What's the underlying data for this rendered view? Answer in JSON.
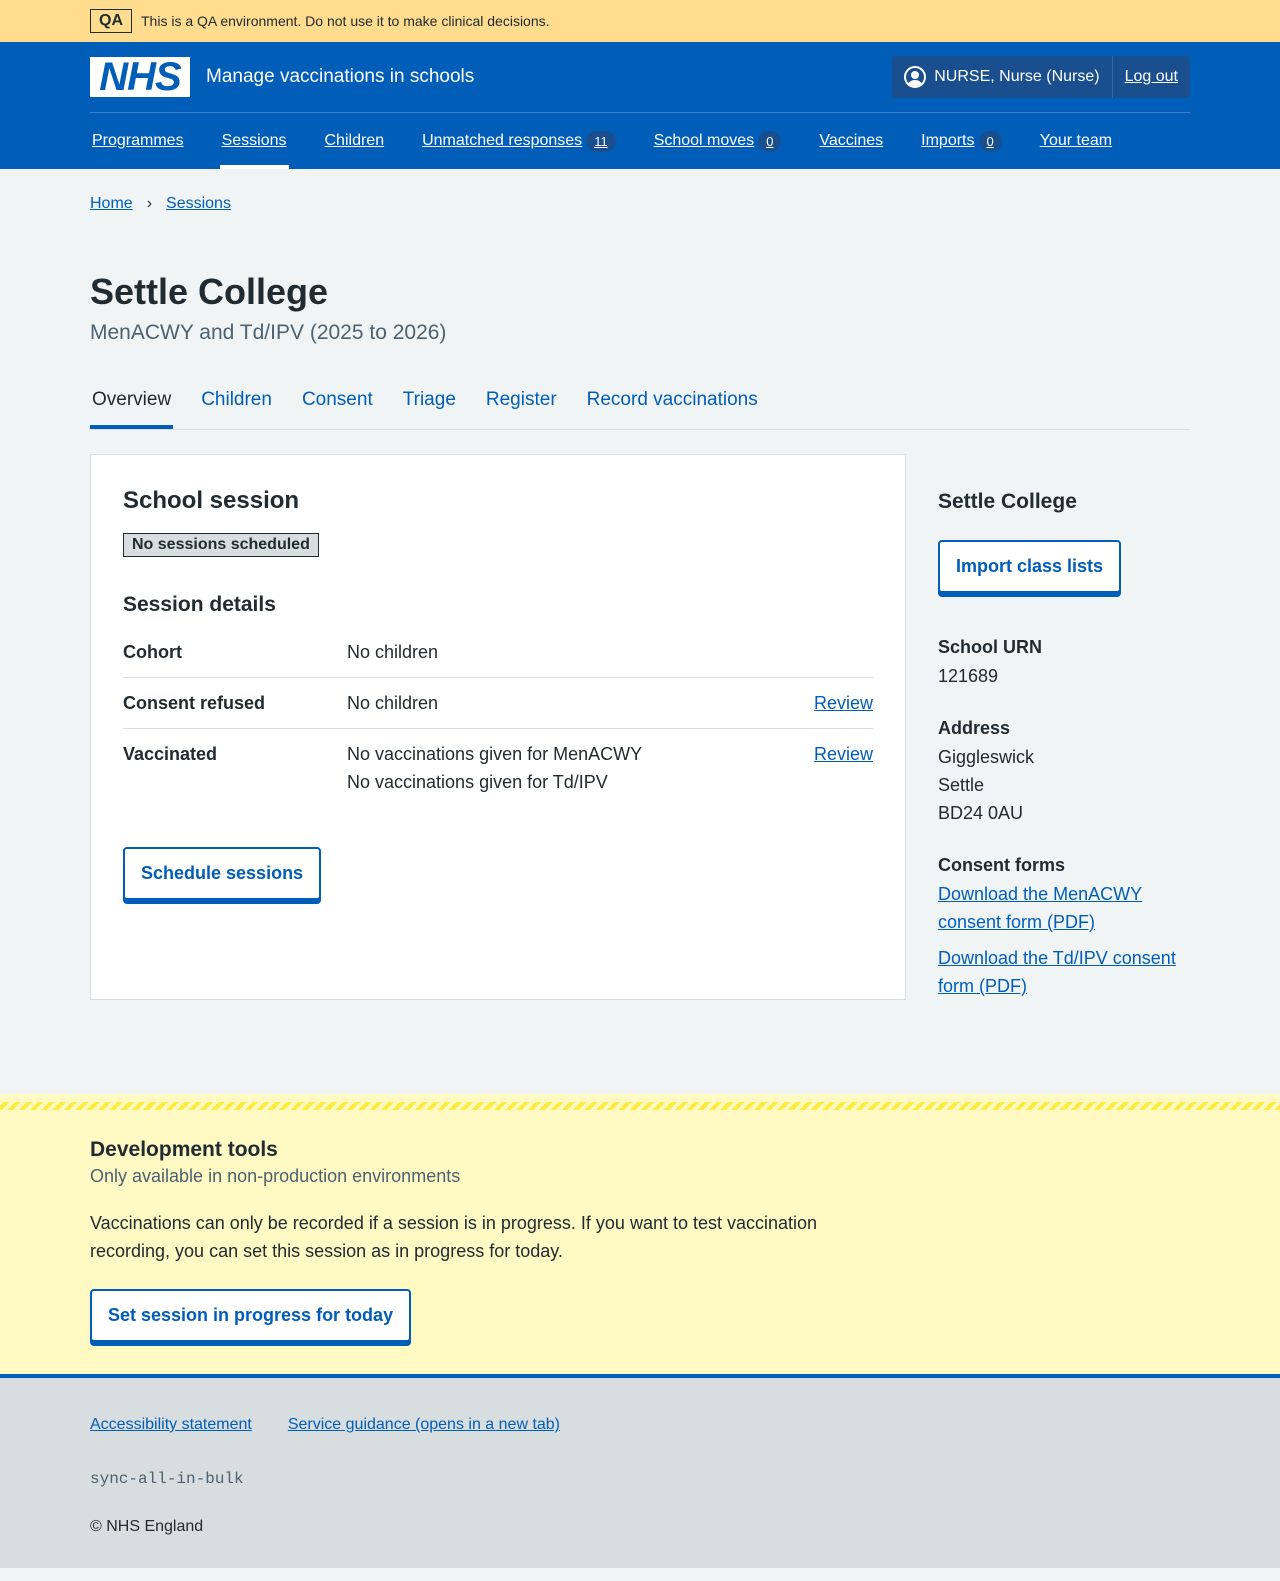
{
  "qa": {
    "tag": "QA",
    "text": "This is a QA environment. Do not use it to make clinical decisions."
  },
  "header": {
    "logo": "NHS",
    "service": "Manage vaccinations in schools",
    "user": "NURSE, Nurse (Nurse)",
    "logout": "Log out"
  },
  "nav": [
    {
      "label": "Programmes"
    },
    {
      "label": "Sessions",
      "current": true
    },
    {
      "label": "Children"
    },
    {
      "label": "Unmatched responses",
      "count": "11"
    },
    {
      "label": "School moves",
      "count": "0"
    },
    {
      "label": "Vaccines"
    },
    {
      "label": "Imports",
      "count": "0"
    },
    {
      "label": "Your team"
    }
  ],
  "breadcrumb": [
    "Home",
    "Sessions"
  ],
  "page": {
    "title": "Settle College",
    "caption": "MenACWY and Td/IPV (2025 to 2026)"
  },
  "tabs": [
    "Overview",
    "Children",
    "Consent",
    "Triage",
    "Register",
    "Record vaccinations"
  ],
  "session": {
    "title": "School session",
    "status": "No sessions scheduled",
    "details_title": "Session details",
    "rows": [
      {
        "key": "Cohort",
        "values": [
          "No children"
        ],
        "action": ""
      },
      {
        "key": "Consent refused",
        "values": [
          "No children"
        ],
        "action": "Review"
      },
      {
        "key": "Vaccinated",
        "values": [
          "No vaccinations given for MenACWY",
          "No vaccinations given for Td/IPV"
        ],
        "action": "Review"
      }
    ],
    "button": "Schedule sessions"
  },
  "side": {
    "title": "Settle College",
    "import": "Import class lists",
    "urn_label": "School URN",
    "urn": "121689",
    "address_label": "Address",
    "address": [
      "Giggleswick",
      "Settle",
      "BD24 0AU"
    ],
    "forms_label": "Consent forms",
    "forms": [
      "Download the MenACWY consent form (PDF)",
      "Download the Td/IPV consent form (PDF)"
    ]
  },
  "dev": {
    "title": "Development tools",
    "subtitle": "Only available in non-production environments",
    "text": "Vaccinations can only be recorded if a session is in progress. If you want to test vaccination recording, you can set this session as in progress for today.",
    "button": "Set session in progress for today"
  },
  "footer": {
    "links": [
      "Accessibility statement",
      "Service guidance (opens in a new tab)"
    ],
    "build": "sync-all-in-bulk",
    "copyright": "© NHS England"
  }
}
